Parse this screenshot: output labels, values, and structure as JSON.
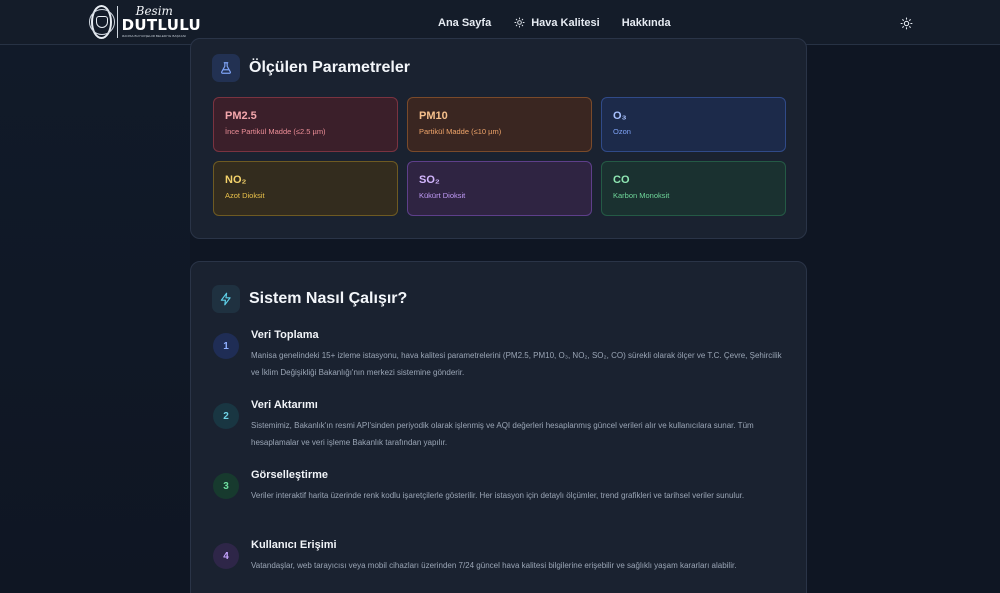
{
  "header": {
    "logo": {
      "script": "Besim",
      "main": "DUTLULU",
      "sub": "MANİSA BÜYÜKŞEHİR BELEDİYE BAŞKANI"
    },
    "nav": [
      {
        "label": "Ana Sayfa",
        "icon": ""
      },
      {
        "label": "Hava Kalitesi",
        "icon": "sun-icon"
      },
      {
        "label": "Hakkında",
        "icon": ""
      }
    ],
    "theme_toggle_icon": "sun-icon"
  },
  "parameters": {
    "title": "Ölçülen Parametreler",
    "icon": "flask-icon",
    "items": [
      {
        "name": "PM2.5",
        "desc": "İnce Partikül Madde (≤2.5 µm)",
        "color": "#f4a7ad"
      },
      {
        "name": "PM10",
        "desc": "Partikül Madde (≤10 µm)",
        "color": "#f6c08c"
      },
      {
        "name": "O₃",
        "desc": "Ozon",
        "color": "#a9c2ff"
      },
      {
        "name": "NO₂",
        "desc": "Azot Dioksit",
        "color": "#f5d36b"
      },
      {
        "name": "SO₂",
        "desc": "Kükürt Dioksit",
        "color": "#d4b7ff"
      },
      {
        "name": "CO",
        "desc": "Karbon Monoksit",
        "color": "#8fe7b3"
      }
    ]
  },
  "how": {
    "title": "Sistem Nasıl Çalışır?",
    "icon": "lightning-icon",
    "steps": [
      {
        "num": "1",
        "title": "Veri Toplama",
        "text": "Manisa genelindeki 15+ izleme istasyonu, hava kalitesi parametrelerini (PM2.5, PM10, O₃, NO₂, SO₂, CO) sürekli olarak ölçer ve T.C. Çevre, Şehircilik ve İklim Değişikliği Bakanlığı'nın merkezi sistemine gönderir."
      },
      {
        "num": "2",
        "title": "Veri Aktarımı",
        "text": "Sistemimiz, Bakanlık'ın resmi API'sinden periyodik olarak işlenmiş ve AQI değerleri hesaplanmış güncel verileri alır ve kullanıcılara sunar. Tüm hesaplamalar ve veri işleme Bakanlık tarafından yapılır."
      },
      {
        "num": "3",
        "title": "Görselleştirme",
        "text": "Veriler interaktif harita üzerinde renk kodlu işaretçilerle gösterilir. Her istasyon için detaylı ölçümler, trend grafikleri ve tarihsel veriler sunulur."
      },
      {
        "num": "4",
        "title": "Kullanıcı Erişimi",
        "text": "Vatandaşlar, web tarayıcısı veya mobil cihazları üzerinden 7/24 güncel hava kalitesi bilgilerine erişebilir ve sağlıklı yaşam kararları alabilir."
      }
    ]
  }
}
